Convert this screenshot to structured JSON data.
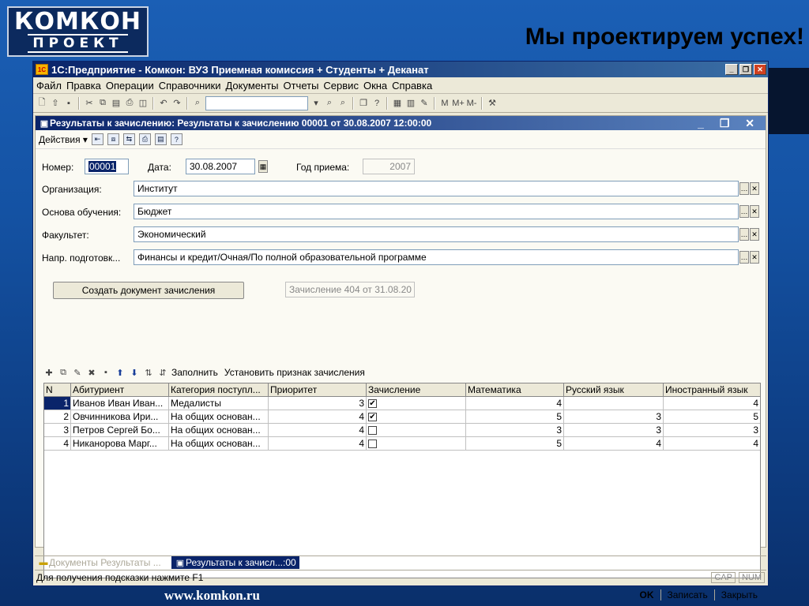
{
  "slide": {
    "logo_line1": "КОМКОН",
    "logo_line2": "ПРОЕКТ",
    "tagline": "Мы проектируем успех!",
    "footer": "www.komkon.ru"
  },
  "window": {
    "title": "1С:Предприятие - Комкон: ВУЗ Приемная комиссия + Студенты + Деканат",
    "app_icon": "1С"
  },
  "menu": [
    "Файл",
    "Правка",
    "Операции",
    "Справочники",
    "Документы",
    "Отчеты",
    "Сервис",
    "Окна",
    "Справка"
  ],
  "doc": {
    "title": "Результаты к зачислению: Результаты к зачислению 00001 от 30.08.2007 12:00:00",
    "actions_label": "Действия"
  },
  "form": {
    "number_label": "Номер:",
    "number_value": "00001",
    "date_label": "Дата:",
    "date_value": "30.08.2007",
    "year_label": "Год приема:",
    "year_value": "2007",
    "org_label": "Организация:",
    "org_value": "Институт",
    "basis_label": "Основа обучения:",
    "basis_value": "Бюджет",
    "faculty_label": "Факультет:",
    "faculty_value": "Экономический",
    "direction_label": "Напр. подготовк...",
    "direction_value": "Финансы и кредит/Очная/По полной образовательной программе",
    "create_button": "Создать документ зачисления",
    "enrollment_doc": "Зачисление 404 от 31.08.20"
  },
  "table_toolbar": {
    "fill": "Заполнить",
    "set_flag": "Установить признак зачисления"
  },
  "table": {
    "columns": [
      "N",
      "Абитуриент",
      "Категория поступл...",
      "Приоритет",
      "Зачисление",
      "Математика",
      "Русский язык",
      "Иностранный язык"
    ],
    "rows": [
      {
        "n": "1",
        "name": "Иванов Иван Иван...",
        "category": "Медалисты",
        "priority": "3",
        "enrolled": true,
        "math": "4",
        "russian": "",
        "foreign": "4"
      },
      {
        "n": "2",
        "name": "Овчинникова Ири...",
        "category": "На общих основан...",
        "priority": "4",
        "enrolled": true,
        "math": "5",
        "russian": "3",
        "foreign": "5"
      },
      {
        "n": "3",
        "name": "Петров Сергей Бо...",
        "category": "На общих основан...",
        "priority": "4",
        "enrolled": false,
        "math": "3",
        "russian": "3",
        "foreign": "3"
      },
      {
        "n": "4",
        "name": "Никанорова Марг...",
        "category": "На общих основан...",
        "priority": "4",
        "enrolled": false,
        "math": "5",
        "russian": "4",
        "foreign": "4"
      }
    ]
  },
  "bottom": {
    "ok": "OK",
    "save": "Записать",
    "close": "Закрыть"
  },
  "taskbar": [
    "Документы Результаты ...",
    "Результаты к зачисл...:00"
  ],
  "status": {
    "hint": "Для получения подсказки нажмите F1",
    "cap": "CAP",
    "num": "NUM"
  }
}
